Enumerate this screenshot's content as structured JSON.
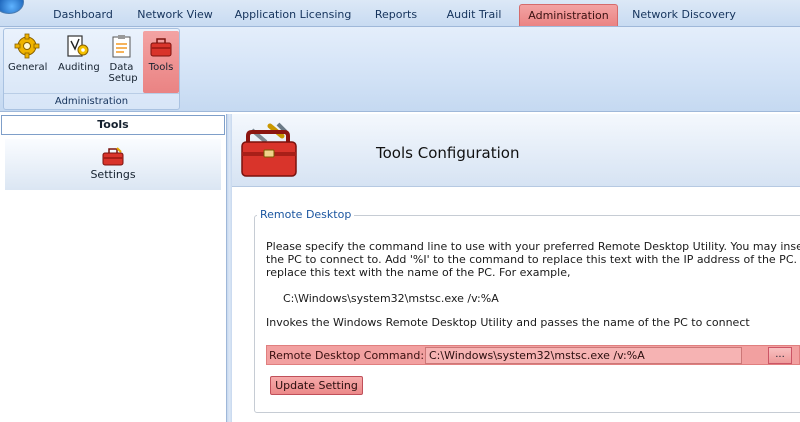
{
  "tabs": [
    {
      "label": "Dashboard",
      "active": false
    },
    {
      "label": "Network View",
      "active": false
    },
    {
      "label": "Application Licensing",
      "active": false
    },
    {
      "label": "Reports",
      "active": false
    },
    {
      "label": "Audit Trail",
      "active": false
    },
    {
      "label": "Administration",
      "active": true
    },
    {
      "label": "Network Discovery",
      "active": false
    }
  ],
  "ribbon": {
    "group_caption": "Administration",
    "buttons": [
      {
        "label": "General",
        "icon": "gear-icon"
      },
      {
        "label": "Auditing",
        "icon": "audit-icon"
      },
      {
        "label": "Data Setup",
        "icon": "clipboard-icon"
      },
      {
        "label": "Tools",
        "icon": "toolbox-icon",
        "active": true
      }
    ]
  },
  "left_panel": {
    "header": "Tools",
    "items": [
      {
        "label": "Settings",
        "icon": "toolbox-icon"
      }
    ]
  },
  "main": {
    "title": "Tools Configuration",
    "section_legend": "Remote Desktop",
    "description_lines": [
      "Please specify the command line to use with your preferred Remote Desktop Utility.  You may insert ei",
      "the PC to connect to.  Add '%I' to the command to replace this text with the IP address of the PC.  Add",
      "replace this text with the name of the PC.  For example,"
    ],
    "example": "C:\\Windows\\system32\\mstsc.exe /v:%A",
    "note": "Invokes the Windows Remote Desktop Utility and passes the name of the PC to connect",
    "command_label": "Remote Desktop Command:",
    "command_value": "C:\\Windows\\system32\\mstsc.exe /v:%A",
    "browse_label": "...",
    "update_label": "Update Setting"
  },
  "colors": {
    "highlight": "#ea8383",
    "ribbon_bg": "#d2e2f6",
    "legend_text": "#1b56a0"
  }
}
